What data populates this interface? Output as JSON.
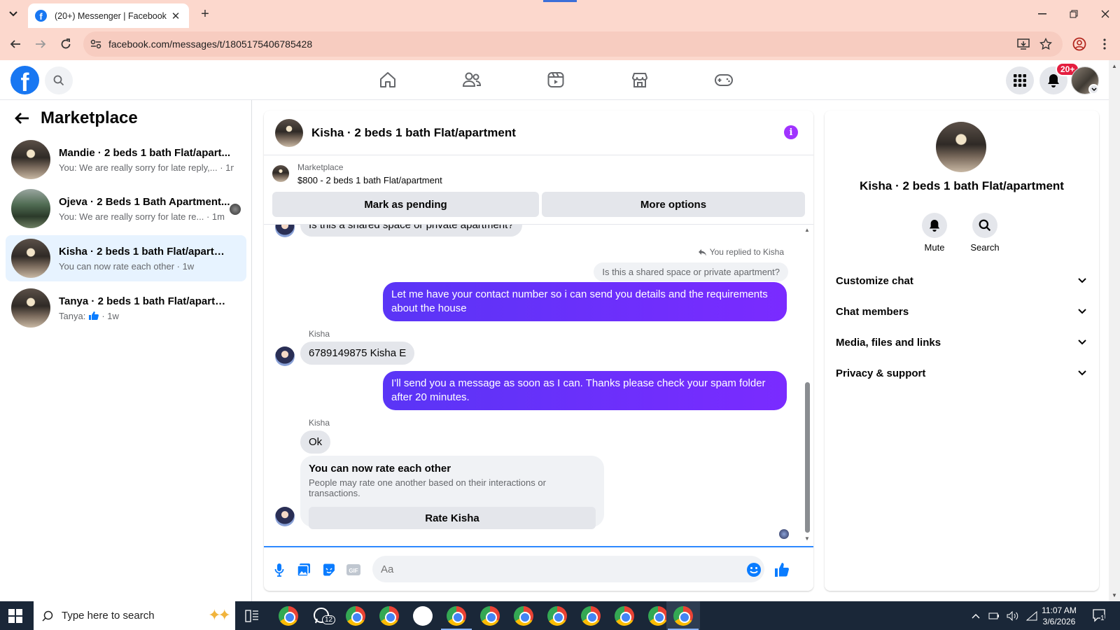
{
  "browser": {
    "tab_title": "(20+) Messenger | Facebook",
    "url": "facebook.com/messages/t/1805175406785428",
    "favicon_letter": "f",
    "colors": {
      "chrome": "#fcd8cd",
      "omnibox": "#f7ccc0"
    }
  },
  "fb_header": {
    "logo_letter": "f",
    "notification_count": "20+",
    "nav_icons": [
      "home-icon",
      "friends-icon",
      "video-icon",
      "marketplace-icon",
      "gaming-icon"
    ],
    "right_icons": [
      "menu-grid-icon",
      "bell-icon",
      "account-avatar"
    ]
  },
  "sidebar": {
    "title": "Marketplace",
    "conversations": [
      {
        "name": "Mandie · 2 beds 1 bath Flat/apart...",
        "preview": "You: We are really sorry for late reply,... · 1m",
        "active": false
      },
      {
        "name": "Ojeva · 2 Beds 1 Bath Apartment...",
        "preview": "You: We are really sorry for late re... · 1m",
        "active": false
      },
      {
        "name": "Kisha · 2 beds 1 bath Flat/apartment",
        "preview": "You can now rate each other · 1w",
        "active": true
      },
      {
        "name": "Tanya · 2 beds 1 bath Flat/apartment",
        "preview_prefix": "Tanya:",
        "preview_suffix": "· 1w",
        "active": false
      }
    ]
  },
  "chat": {
    "title": "Kisha · 2 beds 1 bath Flat/apartment",
    "listing_label": "Marketplace",
    "listing_item": "$800 - 2 beds 1 bath Flat/apartment",
    "mark_pending_label": "Mark as pending",
    "more_options_label": "More options",
    "messages": {
      "partial_top": "Is this a shared space or private apartment?",
      "replied_to": "You replied to Kisha",
      "quoted": "Is this a shared space or private apartment?",
      "out_1": "Let me have your contact number so i can send you details and the requirements about the house",
      "sender_1": "Kisha",
      "in_1": "6789149875 Kisha E",
      "out_2": "I'll send you a message as soon as I can. Thanks please check your spam folder after 20 minutes.",
      "sender_2": "Kisha",
      "in_2": "Ok"
    },
    "rate_card": {
      "title": "You can now rate each other",
      "subtitle": "People may rate one another based on their interactions or transactions.",
      "button": "Rate Kisha"
    },
    "composer_placeholder": "Aa",
    "accent": "#7a2bff"
  },
  "info_panel": {
    "name": "Kisha · 2 beds 1 bath Flat/apartment",
    "mute_label": "Mute",
    "search_label": "Search",
    "sections": [
      "Customize chat",
      "Chat members",
      "Media, files and links",
      "Privacy & support"
    ]
  },
  "taskbar": {
    "search_placeholder": "Type here to search",
    "whatsapp_badge": "12",
    "time": "11:07 AM",
    "date": "3/6/2026",
    "notification_count": "1"
  }
}
